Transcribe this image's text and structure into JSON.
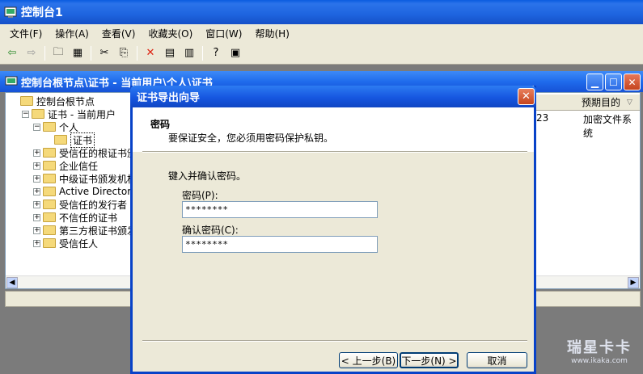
{
  "app": {
    "title": "控制台1",
    "menu": [
      "文件(F)",
      "操作(A)",
      "查看(V)",
      "收藏夹(O)",
      "窗口(W)",
      "帮助(H)"
    ]
  },
  "child": {
    "title": "控制台根节点\\证书 - 当前用户\\个人\\证书"
  },
  "tree": [
    {
      "label": "控制台根节点",
      "indent": 0,
      "expander": ""
    },
    {
      "label": "证书 - 当前用户",
      "indent": 1,
      "expander": "−"
    },
    {
      "label": "个人",
      "indent": 2,
      "expander": "−"
    },
    {
      "label": "证书",
      "indent": 3,
      "expander": ""
    },
    {
      "label": "受信任的根证书颁",
      "indent": 2,
      "expander": "+"
    },
    {
      "label": "企业信任",
      "indent": 2,
      "expander": "+"
    },
    {
      "label": "中级证书颁发机构",
      "indent": 2,
      "expander": "+"
    },
    {
      "label": "Active Director",
      "indent": 2,
      "expander": "+"
    },
    {
      "label": "受信任的发行者",
      "indent": 2,
      "expander": "+"
    },
    {
      "label": "不信任的证书",
      "indent": 2,
      "expander": "+"
    },
    {
      "label": "第三方根证书颁发",
      "indent": 2,
      "expander": "+"
    },
    {
      "label": "受信任人",
      "indent": 2,
      "expander": "+"
    }
  ],
  "list": {
    "column_header": "预期目的",
    "row_partial": "23",
    "row_purpose": "加密文件系统"
  },
  "dialog": {
    "title": "证书导出向导",
    "heading": "密码",
    "subtitle": "要保证安全，您必须用密码保护私钥。",
    "instruction": "键入并确认密码。",
    "password_label": "密码(P):",
    "password_value": "********",
    "confirm_label": "确认密码(C):",
    "confirm_value": "********",
    "back_button": "< 上一步(B)",
    "next_button": "下一步(N) >",
    "cancel_button": "取消"
  },
  "watermark": {
    "text": "瑞星卡卡",
    "url": "www.ikaka.com"
  }
}
